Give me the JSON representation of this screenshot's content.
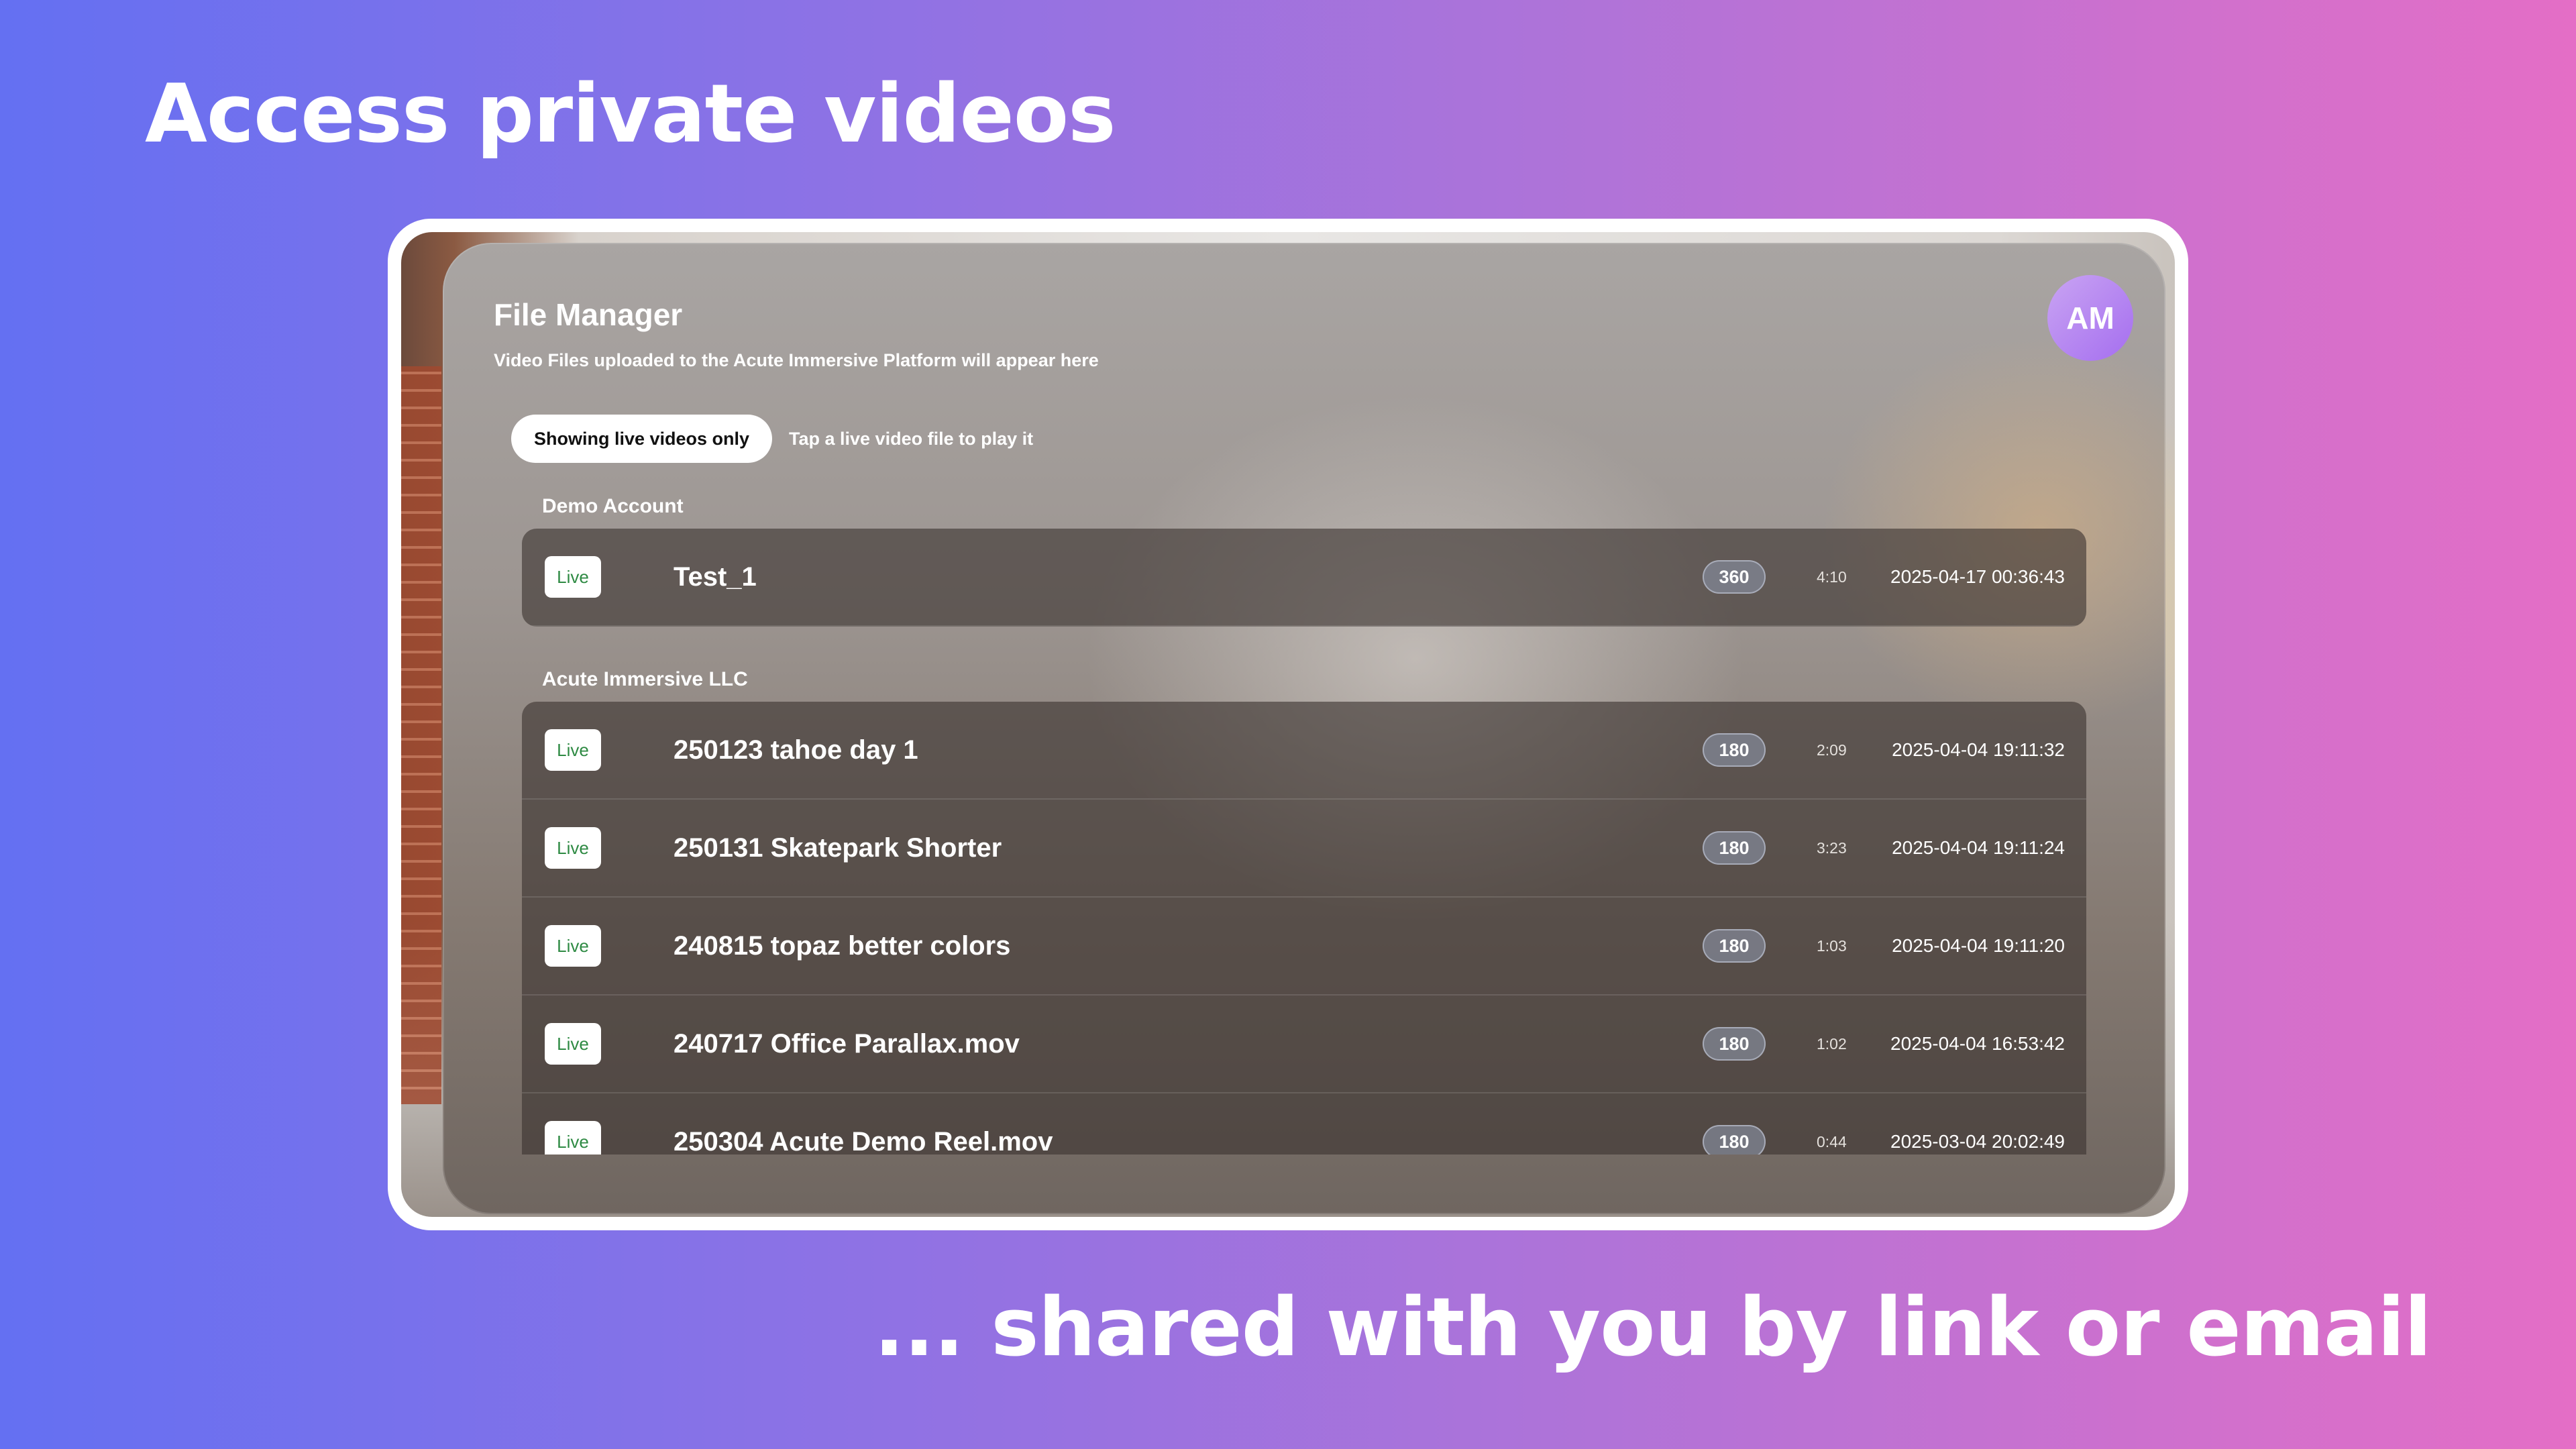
{
  "page": {
    "headline": "Access private videos",
    "subline": "... shared with you by link or email"
  },
  "app": {
    "title": "File Manager",
    "subtitle": "Video Files uploaded to the Acute Immersive Platform will appear here",
    "avatar_initials": "AM",
    "filter_label": "Showing live videos only",
    "filter_hint": "Tap a live video file to play it"
  },
  "groups": [
    {
      "name": "Demo Account",
      "files": [
        {
          "status": "Live",
          "name": "Test_1",
          "format": "360",
          "duration": "4:10",
          "date": "2025-04-17 00:36:43"
        }
      ]
    },
    {
      "name": "Acute Immersive LLC",
      "files": [
        {
          "status": "Live",
          "name": "250123 tahoe day 1",
          "format": "180",
          "duration": "2:09",
          "date": "2025-04-04 19:11:32"
        },
        {
          "status": "Live",
          "name": "250131 Skatepark Shorter",
          "format": "180",
          "duration": "3:23",
          "date": "2025-04-04 19:11:24"
        },
        {
          "status": "Live",
          "name": "240815 topaz better colors",
          "format": "180",
          "duration": "1:03",
          "date": "2025-04-04 19:11:20"
        },
        {
          "status": "Live",
          "name": "240717 Office Parallax.mov",
          "format": "180",
          "duration": "1:02",
          "date": "2025-04-04 16:53:42"
        },
        {
          "status": "Live",
          "name": "250304 Acute Demo Reel.mov",
          "format": "180",
          "duration": "0:44",
          "date": "2025-03-04 20:02:49"
        }
      ]
    }
  ],
  "colors": {
    "live_badge_text": "#2e8a43",
    "avatar": "#a56ef0"
  }
}
